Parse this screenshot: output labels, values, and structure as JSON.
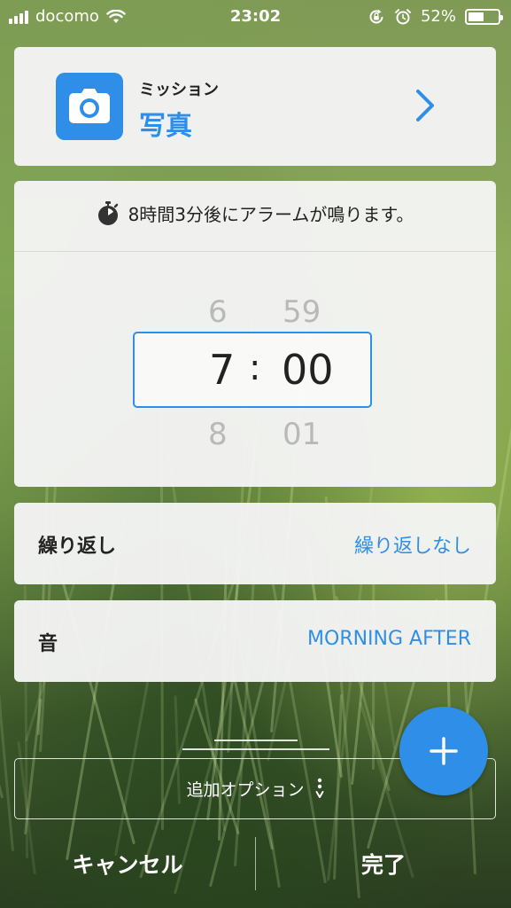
{
  "status_bar": {
    "carrier": "docomo",
    "time": "23:02",
    "battery_percent": "52%",
    "battery_level": 0.52
  },
  "mission": {
    "label": "ミッション",
    "value": "写真",
    "icon": "camera-icon"
  },
  "alarm_time": {
    "countdown_text": "8時間3分後にアラームが鳴ります。",
    "hour_prev": "6",
    "hour_selected": "7",
    "hour_next": "8",
    "separator": ":",
    "minute_prev": "59",
    "minute_selected": "00",
    "minute_next": "01"
  },
  "repeat": {
    "label": "繰り返し",
    "value": "繰り返しなし"
  },
  "sound": {
    "label": "音",
    "value": "MORNING AFTER"
  },
  "extra_options": {
    "label": "追加オプション"
  },
  "buttons": {
    "cancel": "キャンセル",
    "done": "完了"
  },
  "colors": {
    "accent": "#2f8fe8",
    "card_bg": "#f5f5f5"
  }
}
